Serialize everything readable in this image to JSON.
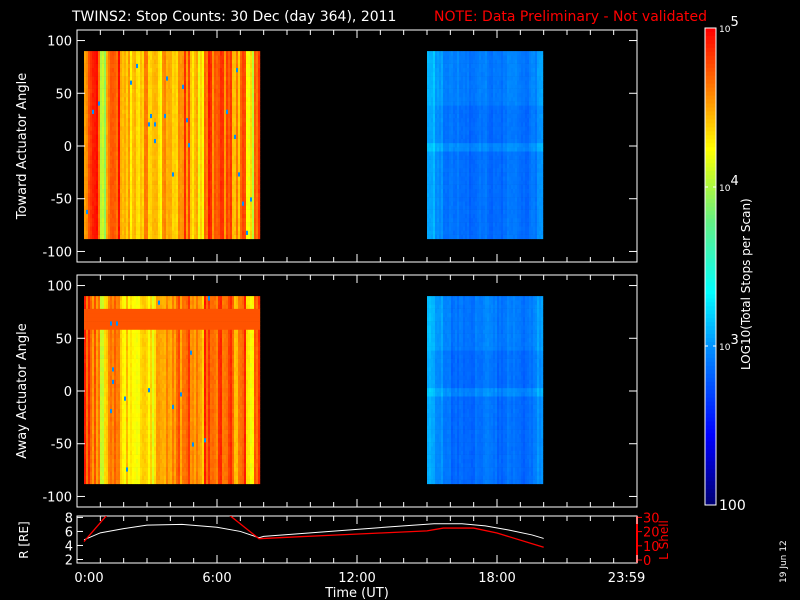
{
  "title": "TWINS2: Stop Counts: 30 Dec (day 364), 2011",
  "note": "NOTE: Data Preliminary - Not validated",
  "date_stamp": "19 Jun 12",
  "colors": {
    "note": "#ff0000",
    "lshell": "#ff0000",
    "rcurve": "#ffffff"
  },
  "chart_data": [
    {
      "type": "heatmap",
      "name": "toward",
      "ylabel": "Toward Actuator Angle",
      "ylim": [
        -110,
        110
      ],
      "yticks": [
        "100",
        "50",
        "0",
        "-50",
        "-100"
      ],
      "xlim_hours": [
        0,
        24
      ],
      "angle_range": [
        -88,
        90
      ],
      "blocks": [
        {
          "start_h": 0.3,
          "end_h": 7.8,
          "log_counts_by_column": [
            4.7,
            4.8,
            4.1,
            4.6,
            4.8,
            4.5,
            4.4,
            4.3,
            4.5,
            4.4,
            4.3,
            4.6,
            4.4,
            4.5,
            4.7,
            4.4,
            4.3,
            4.8,
            4.6,
            4.7,
            4.8,
            4.5,
            4.7,
            4.2,
            4.8
          ]
        },
        {
          "start_h": 15.0,
          "end_h": 20.0,
          "log_counts_by_column": [
            3.1,
            3.0,
            2.9,
            2.9,
            2.85,
            2.85,
            2.9,
            2.9,
            2.85,
            2.85,
            2.9,
            2.9,
            2.85,
            2.9,
            3.0
          ]
        }
      ]
    },
    {
      "type": "heatmap",
      "name": "away",
      "ylabel": "Away Actuator Angle",
      "ylim": [
        -110,
        110
      ],
      "yticks": [
        "100",
        "50",
        "0",
        "-50",
        "-100"
      ],
      "xlim_hours": [
        0,
        24
      ],
      "angle_range": [
        -88,
        90
      ],
      "blocks": [
        {
          "start_h": 0.3,
          "end_h": 7.8,
          "log_counts_by_column": [
            4.8,
            4.6,
            4.2,
            4.5,
            4.6,
            4.4,
            4.4,
            4.3,
            4.4,
            4.3,
            4.4,
            4.6,
            4.5,
            4.6,
            4.7,
            4.5,
            4.4,
            4.8,
            4.7,
            4.8,
            4.8,
            4.6,
            4.8,
            4.3,
            4.8
          ]
        },
        {
          "start_h": 15.0,
          "end_h": 20.0,
          "log_counts_by_column": [
            3.1,
            3.0,
            2.9,
            2.85,
            2.85,
            2.85,
            2.9,
            2.95,
            2.9,
            2.85,
            2.9,
            2.9,
            2.85,
            2.9,
            3.0
          ]
        }
      ]
    },
    {
      "type": "line",
      "name": "orbit",
      "ylabel_left": "R [RE]",
      "ylabel_right": "L Shell",
      "xlabel": "Time (UT)",
      "xticks": [
        "0:00",
        "6:00",
        "12:00",
        "18:00",
        "23:59"
      ],
      "yticks_left": [
        "8",
        "6",
        "4",
        "2"
      ],
      "yticks_right": [
        "30",
        "20",
        "10",
        "0"
      ],
      "ylim_left": [
        1.5,
        8.2
      ],
      "ylim_right": [
        0,
        31
      ],
      "series": [
        {
          "name": "R",
          "x": [
            0.3,
            1,
            2,
            3,
            4.5,
            6,
            7,
            7.8,
            8,
            10,
            12,
            14,
            15.3,
            16.5,
            17.5,
            18.5,
            19.5,
            20
          ],
          "y": [
            4.8,
            5.8,
            6.4,
            6.9,
            7,
            6.6,
            6.0,
            5.1,
            5.3,
            5.8,
            6.3,
            6.8,
            7.1,
            7.1,
            6.8,
            6.2,
            5.5,
            5.0
          ]
        },
        {
          "name": "L Shell",
          "segments": [
            {
              "x": [
                0.3,
                1.3
              ],
              "y": [
                13,
                32
              ]
            },
            {
              "x": [
                6.5,
                7.8,
                9,
                11,
                13,
                15,
                15.7,
                17,
                18,
                20
              ],
              "y": [
                32,
                15,
                16,
                17.5,
                19,
                20.5,
                22.5,
                22.5,
                19,
                9
              ]
            }
          ]
        }
      ]
    },
    {
      "type": "colorbar",
      "label": "LOG10(Total Stops per Scan)",
      "ticks": [
        "10^5",
        "10^4",
        "10^3",
        "100"
      ],
      "log_range": [
        2,
        5
      ]
    }
  ]
}
